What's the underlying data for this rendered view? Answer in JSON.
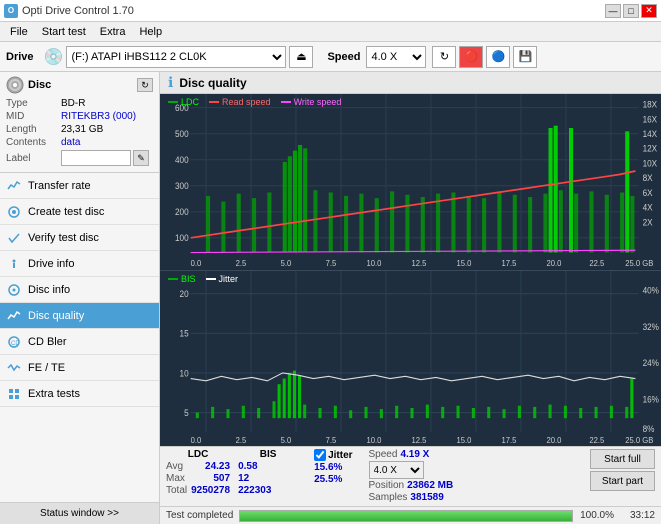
{
  "titlebar": {
    "title": "Opti Drive Control 1.70",
    "icon": "O",
    "minimize_label": "—",
    "maximize_label": "□",
    "close_label": "✕"
  },
  "menubar": {
    "items": [
      "File",
      "Start test",
      "Extra",
      "Help"
    ]
  },
  "drivebar": {
    "drive_label": "Drive",
    "drive_value": "(F:) ATAPI iHBS112  2 CL0K",
    "speed_label": "Speed",
    "speed_value": "4.0 X"
  },
  "disc": {
    "title": "Disc",
    "type_label": "Type",
    "type_value": "BD-R",
    "mid_label": "MID",
    "mid_value": "RITEKBR3 (000)",
    "length_label": "Length",
    "length_value": "23,31 GB",
    "contents_label": "Contents",
    "contents_value": "data",
    "label_label": "Label",
    "label_value": ""
  },
  "nav": {
    "items": [
      {
        "id": "transfer-rate",
        "label": "Transfer rate",
        "icon": "chart"
      },
      {
        "id": "create-test-disc",
        "label": "Create test disc",
        "icon": "disc"
      },
      {
        "id": "verify-test-disc",
        "label": "Verify test disc",
        "icon": "check"
      },
      {
        "id": "drive-info",
        "label": "Drive info",
        "icon": "info"
      },
      {
        "id": "disc-info",
        "label": "Disc info",
        "icon": "disc-info"
      },
      {
        "id": "disc-quality",
        "label": "Disc quality",
        "icon": "quality",
        "active": true
      },
      {
        "id": "cd-bler",
        "label": "CD Bler",
        "icon": "cd"
      },
      {
        "id": "fe-te",
        "label": "FE / TE",
        "icon": "fe-te"
      },
      {
        "id": "extra-tests",
        "label": "Extra tests",
        "icon": "extra"
      }
    ],
    "status_window": "Status window >>"
  },
  "quality": {
    "title": "Disc quality",
    "chart_top": {
      "legend": [
        "LDC",
        "Read speed",
        "Write speed"
      ],
      "y_left": [
        "600",
        "500",
        "400",
        "300",
        "200",
        "100",
        "0"
      ],
      "y_right": [
        "18X",
        "16X",
        "14X",
        "12X",
        "10X",
        "8X",
        "6X",
        "4X",
        "2X"
      ],
      "x_axis": [
        "0.0",
        "2.5",
        "5.0",
        "7.5",
        "10.0",
        "12.5",
        "15.0",
        "17.5",
        "20.0",
        "22.5",
        "25.0 GB"
      ]
    },
    "chart_bottom": {
      "legend": [
        "BIS",
        "Jitter"
      ],
      "y_left": [
        "20",
        "15",
        "10",
        "5"
      ],
      "y_right": [
        "40%",
        "32%",
        "24%",
        "16%",
        "8%"
      ],
      "x_axis": [
        "0.0",
        "2.5",
        "5.0",
        "7.5",
        "10.0",
        "12.5",
        "15.0",
        "17.5",
        "20.0",
        "22.5",
        "25.0 GB"
      ]
    }
  },
  "stats": {
    "ldc_label": "LDC",
    "bis_label": "BIS",
    "jitter_label": "Jitter",
    "speed_label": "Speed",
    "avg_label": "Avg",
    "max_label": "Max",
    "total_label": "Total",
    "ldc_avg": "24.23",
    "ldc_max": "507",
    "ldc_total": "9250278",
    "bis_avg": "0.58",
    "bis_max": "12",
    "bis_total": "222303",
    "jitter_avg": "15.6%",
    "jitter_max": "25.5%",
    "speed_val": "4.19 X",
    "speed_select": "4.0 X",
    "position_label": "Position",
    "position_val": "23862 MB",
    "samples_label": "Samples",
    "samples_val": "381589",
    "start_full": "Start full",
    "start_part": "Start part"
  },
  "progressbar": {
    "status": "Test completed",
    "percent": "100.0%",
    "time": "33:12",
    "width": 100
  }
}
